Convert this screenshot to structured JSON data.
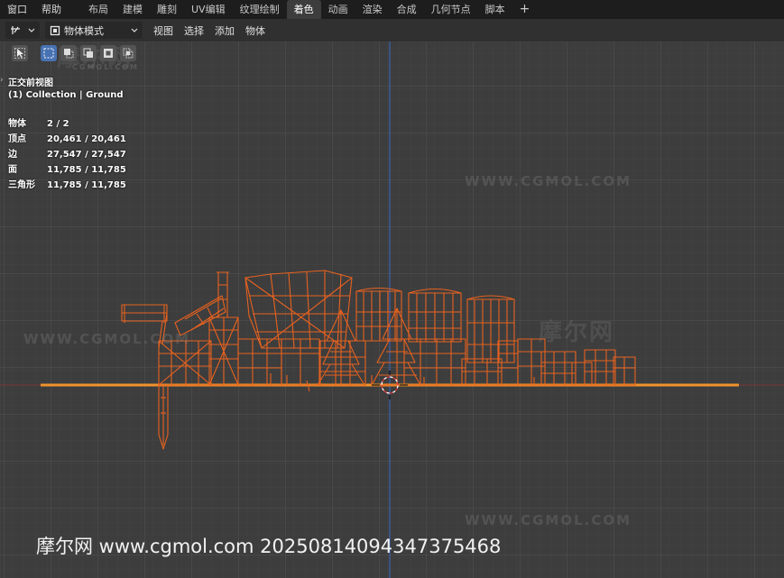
{
  "menu": {
    "window": "窗口",
    "help": "帮助"
  },
  "workspaces": [
    {
      "label": "布局",
      "active": false
    },
    {
      "label": "建模",
      "active": false
    },
    {
      "label": "雕刻",
      "active": false
    },
    {
      "label": "UV编辑",
      "active": false
    },
    {
      "label": "纹理绘制",
      "active": false
    },
    {
      "label": "着色",
      "active": true
    },
    {
      "label": "动画",
      "active": false
    },
    {
      "label": "渲染",
      "active": false
    },
    {
      "label": "合成",
      "active": false
    },
    {
      "label": "几何节点",
      "active": false
    },
    {
      "label": "脚本",
      "active": false
    }
  ],
  "workspace_add": "+",
  "header": {
    "mode": "物体模式",
    "view": "视图",
    "select": "选择",
    "add": "添加",
    "object": "物体"
  },
  "viewport": {
    "view_name": "正交前视图",
    "collection": "(1) Collection | Ground",
    "stats": [
      {
        "label": "物体",
        "value": "2 / 2"
      },
      {
        "label": "顶点",
        "value": "20,461 / 20,461"
      },
      {
        "label": "边",
        "value": "27,547 / 27,547"
      },
      {
        "label": "面",
        "value": "11,785 / 11,785"
      },
      {
        "label": "三角形",
        "value": "11,785 / 11,785"
      }
    ]
  },
  "watermarks": {
    "small": "CGMOL.COM",
    "large": "WWW.CGMOL.COM",
    "cn": "摩尔网",
    "footer": "摩尔网 www.cgmol.com 20250814094347375468"
  },
  "colors": {
    "wire": "#e8621f",
    "ground": "#f0922c",
    "z_axis": "#3d5fa8",
    "x_axis": "#9b3a3a",
    "active_tab": "#3d3d3d",
    "selected_tool": "#4772b3"
  }
}
